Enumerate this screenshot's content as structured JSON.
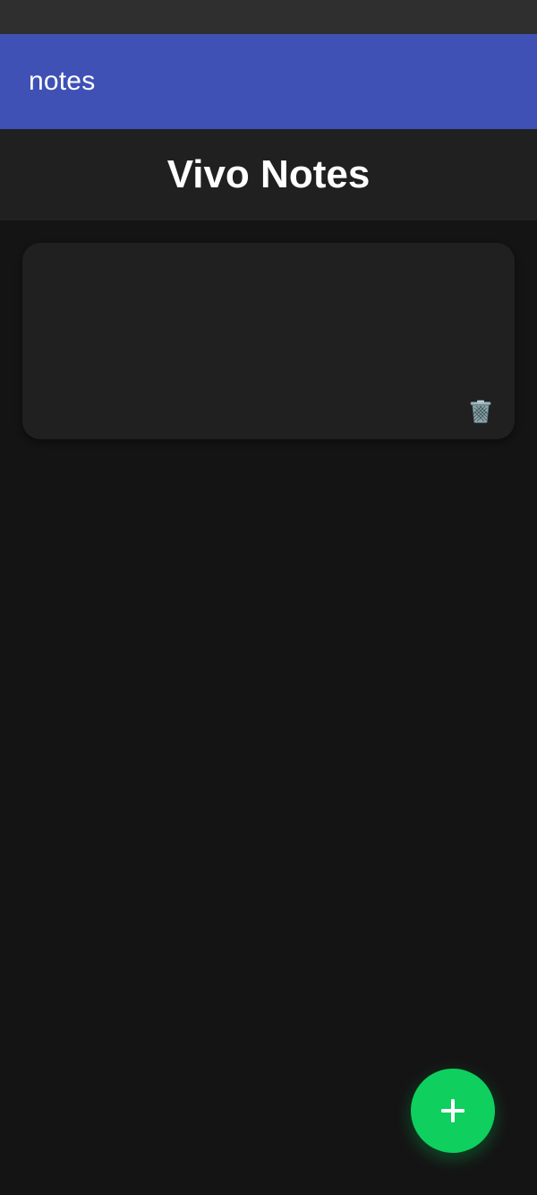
{
  "app_bar": {
    "title": "notes",
    "color": "#3f51b5"
  },
  "header": {
    "title": "Vivo Notes"
  },
  "notes": [
    {
      "title": "",
      "body": "",
      "delete_icon": "trash-can-icon"
    }
  ],
  "fab": {
    "icon": "plus-icon",
    "color": "#0fcf5f"
  },
  "theme": {
    "background": "#141414",
    "card": "#202020",
    "status_bar": "#2f2f2f"
  }
}
